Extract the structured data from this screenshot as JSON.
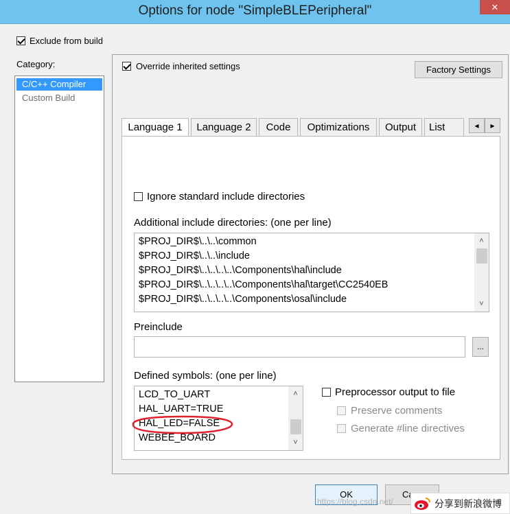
{
  "window": {
    "title": "Options for node \"SimpleBLEPeripheral\"",
    "close_glyph": "✕"
  },
  "exclude_from_build": {
    "label": "Exclude from build",
    "checked": true
  },
  "category": {
    "label": "Category:",
    "items": [
      {
        "label": "C/C++ Compiler",
        "selected": true
      },
      {
        "label": "Custom Build",
        "selected": false
      }
    ]
  },
  "override": {
    "label": "Override inherited settings",
    "checked": true
  },
  "factory_settings_label": "Factory Settings",
  "tabs": [
    {
      "label": "Language 1"
    },
    {
      "label": "Language 2"
    },
    {
      "label": "Code"
    },
    {
      "label": "Optimizations"
    },
    {
      "label": "Output"
    },
    {
      "label": "List"
    }
  ],
  "tab_scroll": {
    "left": "◂",
    "right": "▸"
  },
  "ignore_std": {
    "label": "Ignore standard include directories",
    "checked": false
  },
  "include_dirs": {
    "label": "Additional include directories: (one per line)",
    "lines": [
      "$PROJ_DIR$\\..\\..\\common",
      "$PROJ_DIR$\\..\\..\\include",
      "$PROJ_DIR$\\..\\..\\..\\..\\Components\\hal\\include",
      "$PROJ_DIR$\\..\\..\\..\\..\\Components\\hal\\target\\CC2540EB",
      "$PROJ_DIR$\\..\\..\\..\\..\\Components\\osal\\include"
    ]
  },
  "preinclude": {
    "label": "Preinclude",
    "value": "",
    "browse_label": "..."
  },
  "defined_symbols": {
    "label": "Defined symbols: (one per line)",
    "lines": [
      "LCD_TO_UART",
      "HAL_UART=TRUE",
      "HAL_LED=FALSE",
      "WEBEE_BOARD"
    ]
  },
  "preprocessor": {
    "output_label": "Preprocessor output to file",
    "preserve_label": "Preserve comments",
    "generate_label": "Generate #line directives"
  },
  "buttons": {
    "ok_label": "OK",
    "cancel_label": "Ca"
  },
  "watermark": {
    "text": "https://blog.csdn.net/",
    "weibo_label": "分享到新浪微博"
  },
  "colors": {
    "selection": "#3399ff",
    "annotation": "#e0202a",
    "title_bar": "#6ec4ee"
  }
}
